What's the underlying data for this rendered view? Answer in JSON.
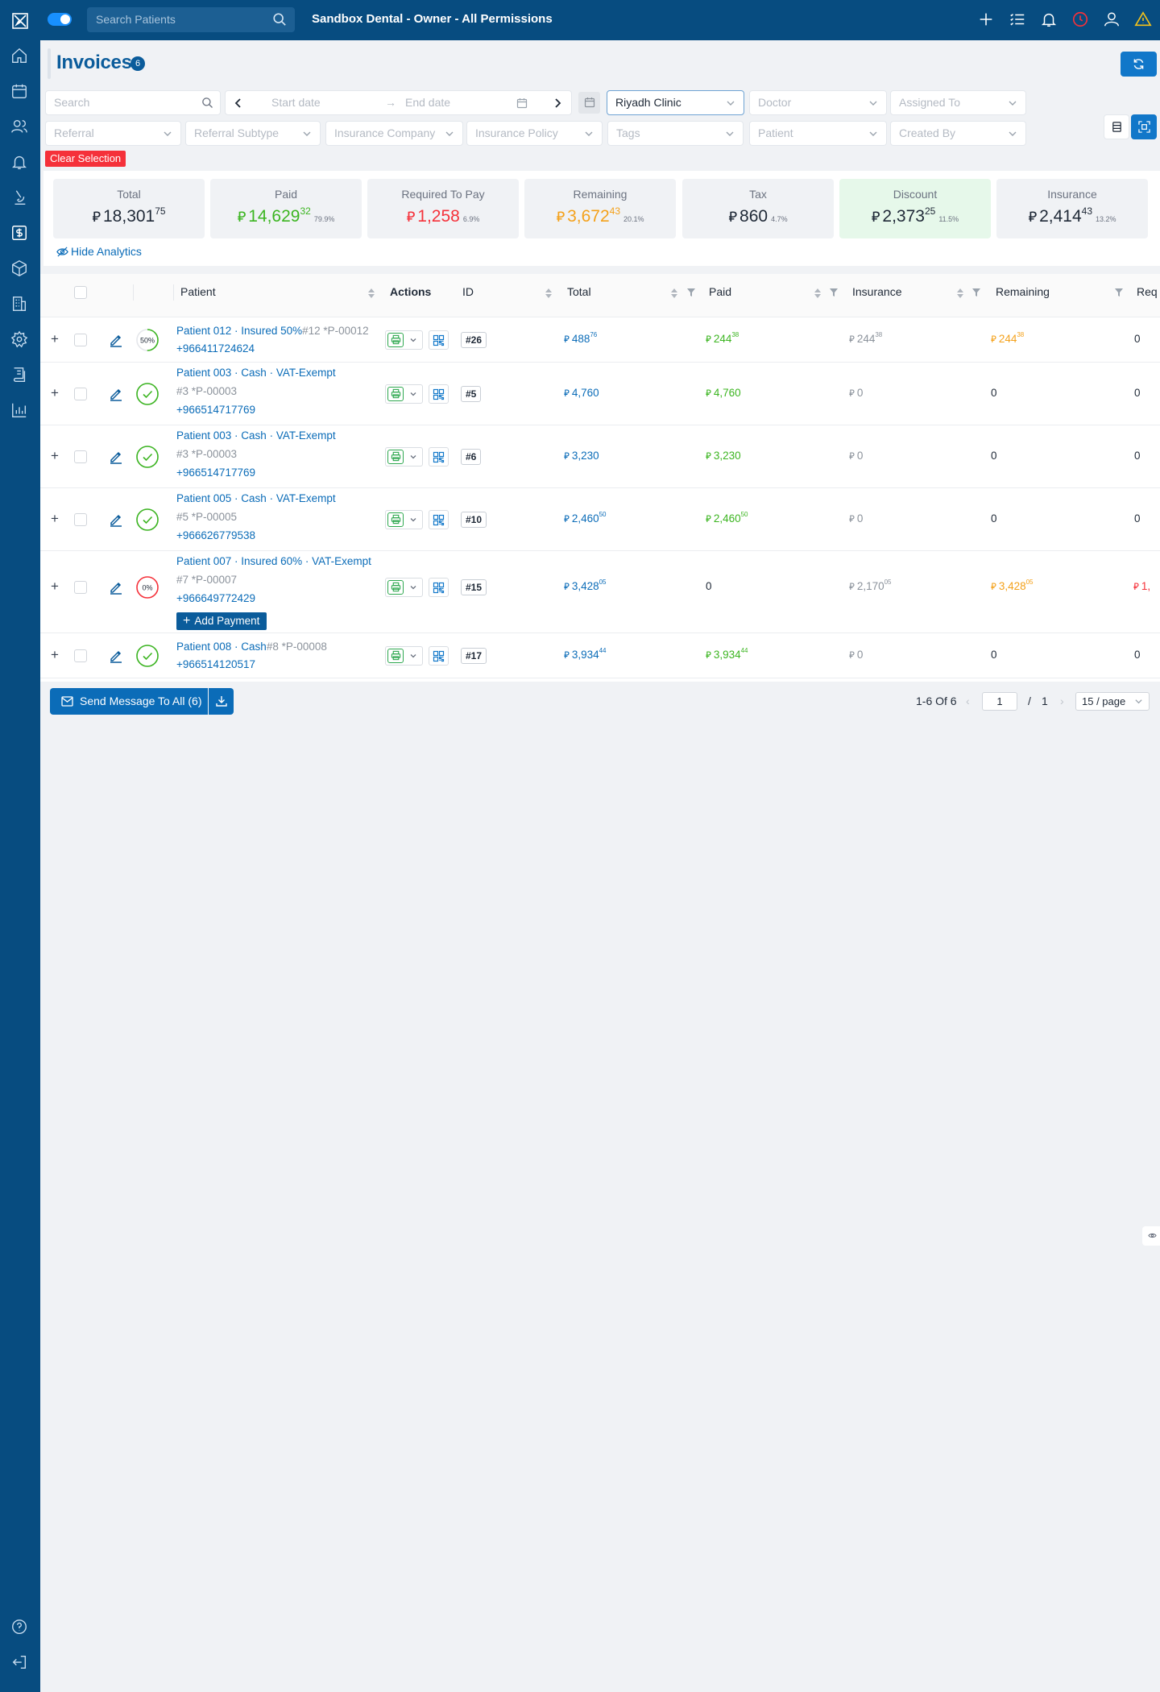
{
  "topbar": {
    "search_placeholder": "Search Patients",
    "clinic_title": "Sandbox Dental - Owner - All Permissions"
  },
  "page": {
    "title": "Invoices",
    "count": "6"
  },
  "filters": {
    "search_placeholder": "Search",
    "start_date": "Start date",
    "end_date": "End date",
    "clinic": "Riyadh Clinic",
    "doctor": "Doctor",
    "assigned_to": "Assigned To",
    "referral": "Referral",
    "referral_subtype": "Referral Subtype",
    "insurance_company": "Insurance Company",
    "insurance_policy": "Insurance Policy",
    "tags": "Tags",
    "patient": "Patient",
    "created_by": "Created By",
    "clear_selection": "Clear Selection"
  },
  "stats": [
    {
      "label": "Total",
      "int": "18,301",
      "dec": "75",
      "pct": "",
      "color": "#1f2937",
      "bg": "#f0f2f5"
    },
    {
      "label": "Paid",
      "int": "14,629",
      "dec": "32",
      "pct": "79.9%",
      "color": "#3cb521",
      "bg": "#f0f2f5"
    },
    {
      "label": "Required To Pay",
      "int": "1,258",
      "dec": "",
      "pct": "6.9%",
      "color": "#f5313a",
      "bg": "#f0f2f5"
    },
    {
      "label": "Remaining",
      "int": "3,672",
      "dec": "43",
      "pct": "20.1%",
      "color": "#f4a11a",
      "bg": "#f0f2f5"
    },
    {
      "label": "Tax",
      "int": "860",
      "dec": "",
      "pct": "4.7%",
      "color": "#1f2937",
      "bg": "#f0f2f5"
    },
    {
      "label": "Discount",
      "int": "2,373",
      "dec": "25",
      "pct": "11.5%",
      "color": "#1f2937",
      "bg": "#e6f8ea"
    },
    {
      "label": "Insurance",
      "int": "2,414",
      "dec": "43",
      "pct": "13.2%",
      "color": "#1f2937",
      "bg": "#f0f2f5"
    }
  ],
  "currency_symbol": "⃁",
  "hide_analytics": "Hide Analytics",
  "table": {
    "columns": {
      "patient": "Patient",
      "actions": "Actions",
      "id": "ID",
      "total": "Total",
      "paid": "Paid",
      "insurance": "Insurance",
      "remaining": "Remaining",
      "req": "Req"
    },
    "rows": [
      {
        "name": "Patient 012 · Insured 50%",
        "file": "#12 *P-00012",
        "phone": "+966411724624",
        "progress": "50%",
        "id": "#26",
        "total_i": "488",
        "total_d": "76",
        "paid_i": "244",
        "paid_d": "38",
        "ins_i": "244",
        "ins_d": "38",
        "rem_i": "244",
        "rem_d": "38",
        "req": "0"
      },
      {
        "name": "Patient 003 · Cash · VAT-Exempt",
        "file": "#3 *P-00003",
        "phone": "+966514717769",
        "progress": "100%",
        "id": "#5",
        "total_i": "4,760",
        "total_d": "",
        "paid_i": "4,760",
        "paid_d": "",
        "ins_i": "0",
        "ins_d": "",
        "rem_i": "0",
        "rem_d": "",
        "req": "0"
      },
      {
        "name": "Patient 003 · Cash · VAT-Exempt",
        "file": "#3 *P-00003",
        "phone": "+966514717769",
        "progress": "100%",
        "id": "#6",
        "total_i": "3,230",
        "total_d": "",
        "paid_i": "3,230",
        "paid_d": "",
        "ins_i": "0",
        "ins_d": "",
        "rem_i": "0",
        "rem_d": "",
        "req": "0"
      },
      {
        "name": "Patient 005 · Cash · VAT-Exempt",
        "file": "#5 *P-00005",
        "phone": "+966626779538",
        "progress": "100%",
        "id": "#10",
        "total_i": "2,460",
        "total_d": "50",
        "paid_i": "2,460",
        "paid_d": "50",
        "ins_i": "0",
        "ins_d": "",
        "rem_i": "0",
        "rem_d": "",
        "req": "0"
      },
      {
        "name": "Patient 007 · Insured 60% · VAT-Exempt",
        "file": "#7 *P-00007",
        "phone": "+966649772429",
        "progress": "0%",
        "id": "#15",
        "total_i": "3,428",
        "total_d": "05",
        "paid_i": "0",
        "paid_d": "",
        "ins_i": "2,170",
        "ins_d": "05",
        "rem_i": "3,428",
        "rem_d": "05",
        "req": "1,"
      },
      {
        "name": "Patient 008 · Cash",
        "file": "#8 *P-00008",
        "phone": "+966514120517",
        "progress": "100%",
        "id": "#17",
        "total_i": "3,934",
        "total_d": "44",
        "paid_i": "3,934",
        "paid_d": "44",
        "ins_i": "0",
        "ins_d": "",
        "rem_i": "0",
        "rem_d": "",
        "req": "0"
      }
    ],
    "add_payment": "Add Payment"
  },
  "footer": {
    "send_message": "Send Message To All (6)",
    "range": "1-6 Of 6",
    "page": "1",
    "slash": "/",
    "total_pages": "1",
    "page_size": "15 / page"
  }
}
